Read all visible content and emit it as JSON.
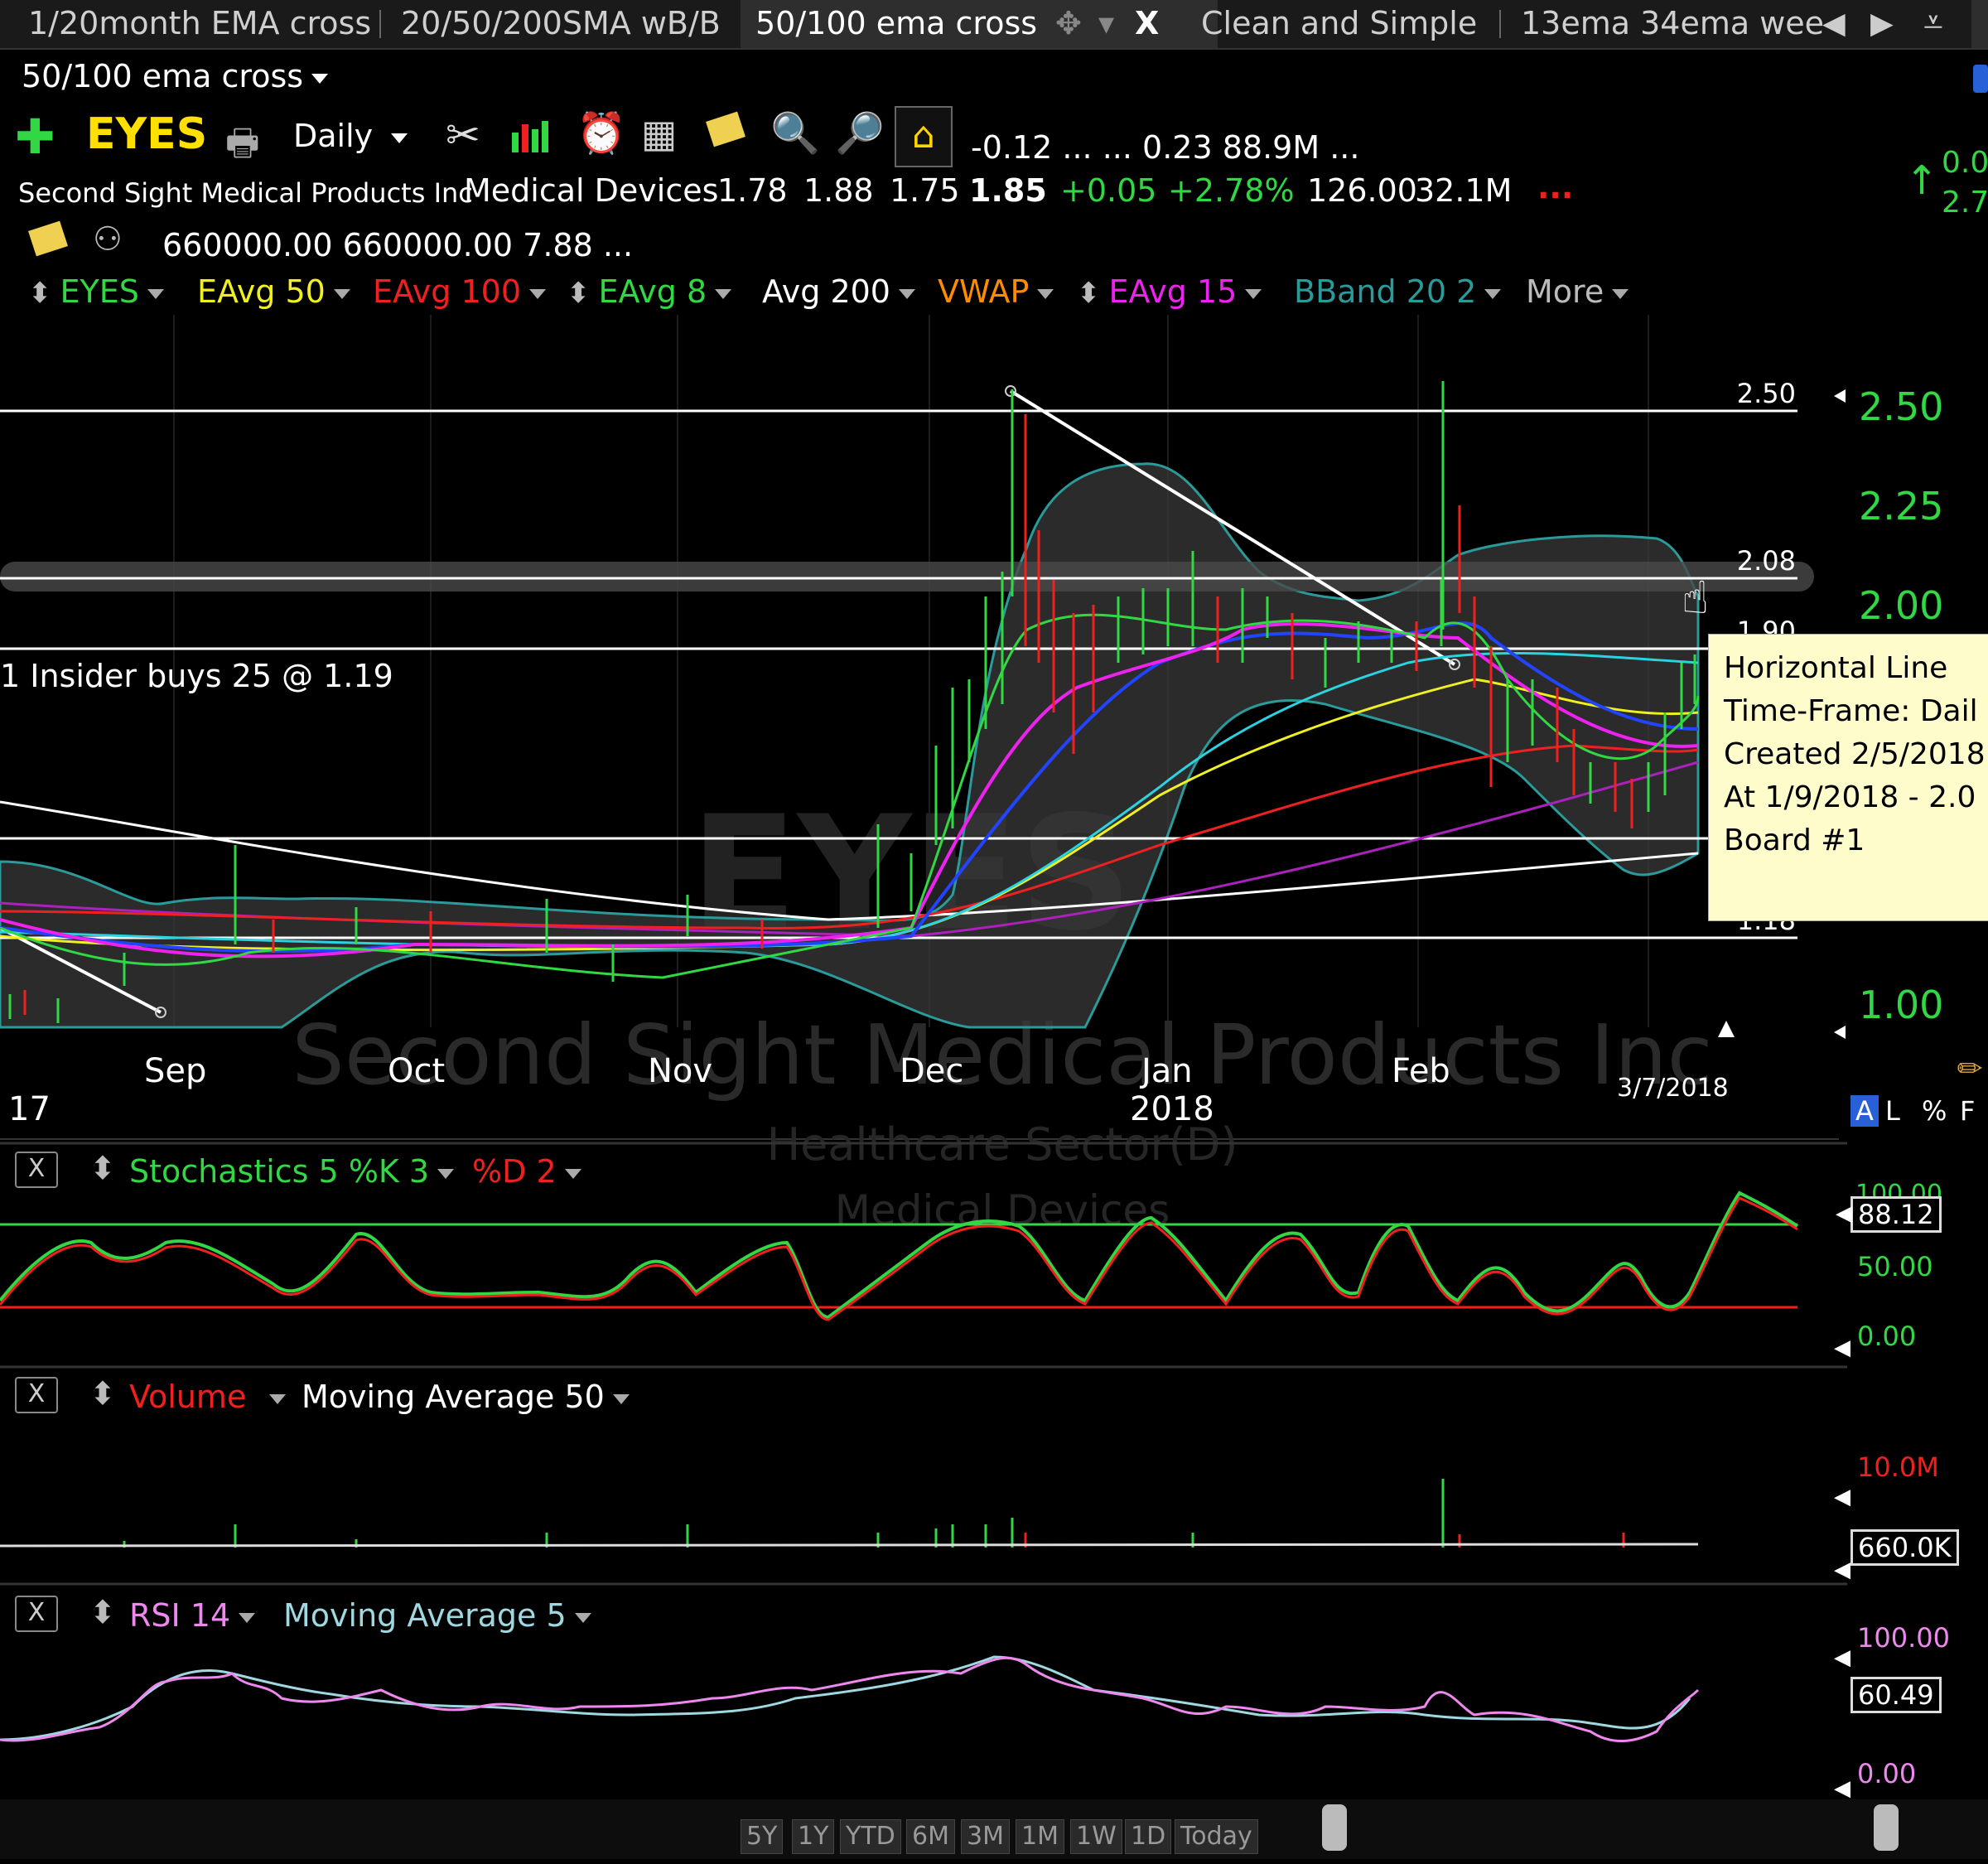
{
  "tabs": [
    "1/20month EMA cross",
    "20/50/200SMA wB/B",
    "50/100 ema cross",
    "Clean and Simple",
    "13ema 34ema wee"
  ],
  "layout_title": "50/100 ema cross",
  "symbol": "EYES",
  "timeframe": "Daily",
  "quote_row1": "-0.12  ...   ...  0.23  88.9M  ...",
  "right_quote_top": "0.0",
  "right_quote_bottom": "2.7",
  "company": "Second Sight Medical Products Inc",
  "industry": "Medical Devices",
  "quote_open": "1.78",
  "quote_high": "1.88",
  "quote_low": "1.75",
  "quote_last": "1.85",
  "quote_change": "+0.05",
  "quote_change_pct": "+2.78%",
  "quote_extra": "126.00",
  "quote_volume": "32.1M",
  "quote_dots": "...",
  "info_row3": "660000.00  660000.00  7.88  ...",
  "indicators": [
    {
      "label": "EYES",
      "color": "#31d843"
    },
    {
      "label": "EAvg 50",
      "color": "#f0f020"
    },
    {
      "label": "EAvg 100",
      "color": "#f02020"
    },
    {
      "label": "EAvg 8",
      "color": "#31d843"
    },
    {
      "label": "Avg 200",
      "color": "#ffffff"
    },
    {
      "label": "VWAP",
      "color": "#ff8c00"
    },
    {
      "label": "EAvg 15",
      "color": "#ee22ee"
    },
    {
      "label": "BBand 20 2",
      "color": "#2a9a9a"
    },
    {
      "label": "More",
      "color": "#bbbbbb"
    }
  ],
  "hlines": [
    "2.50",
    "2.08",
    "1.90",
    "1.18"
  ],
  "price_axis": [
    "2.50",
    "2.25",
    "2.00",
    "1.00"
  ],
  "insider_note": "1 Insider buys 25 @ 1.19",
  "month_labels": [
    "Sep",
    "Oct",
    "Nov",
    "Dec",
    "Jan",
    "Feb"
  ],
  "year_left": "17",
  "year_2018": "2018",
  "date_label": "3/7/2018",
  "watermark": {
    "company": "Second Sight Medical Products Inc",
    "sector": "Healthcare Sector(D)",
    "industry": "Medical Devices",
    "symbol": "EYES"
  },
  "scale_buttons": [
    "A",
    "L",
    "%",
    "F"
  ],
  "tooltip": [
    "Horizontal Line",
    "Time-Frame: Dail",
    "Created 2/5/2018",
    "At 1/9/2018 - 2.0",
    "Board #1"
  ],
  "close_button": "X",
  "stoch": {
    "label": "Stochastics 5 %K 3",
    "d_label": "%D 2",
    "axis": [
      "100.00",
      "50.00",
      "0.00"
    ],
    "value": "88.12"
  },
  "volume": {
    "label": "Volume",
    "ma_label": "Moving Average 50",
    "axis": [
      "10.0M"
    ],
    "value": "660.0K"
  },
  "rsi": {
    "label": "RSI 14",
    "ma_label": "Moving Average 5",
    "axis": [
      "100.00",
      "0.00"
    ],
    "value": "60.49"
  },
  "time_buttons": [
    "5Y",
    "1Y",
    "YTD",
    "6M",
    "3M",
    "1M",
    "1W",
    "1D",
    "Today"
  ],
  "colors": {
    "up": "#31d843",
    "down": "#f02020",
    "bband": "#2a9a9a",
    "tooltip_bg": "#fffccc"
  }
}
